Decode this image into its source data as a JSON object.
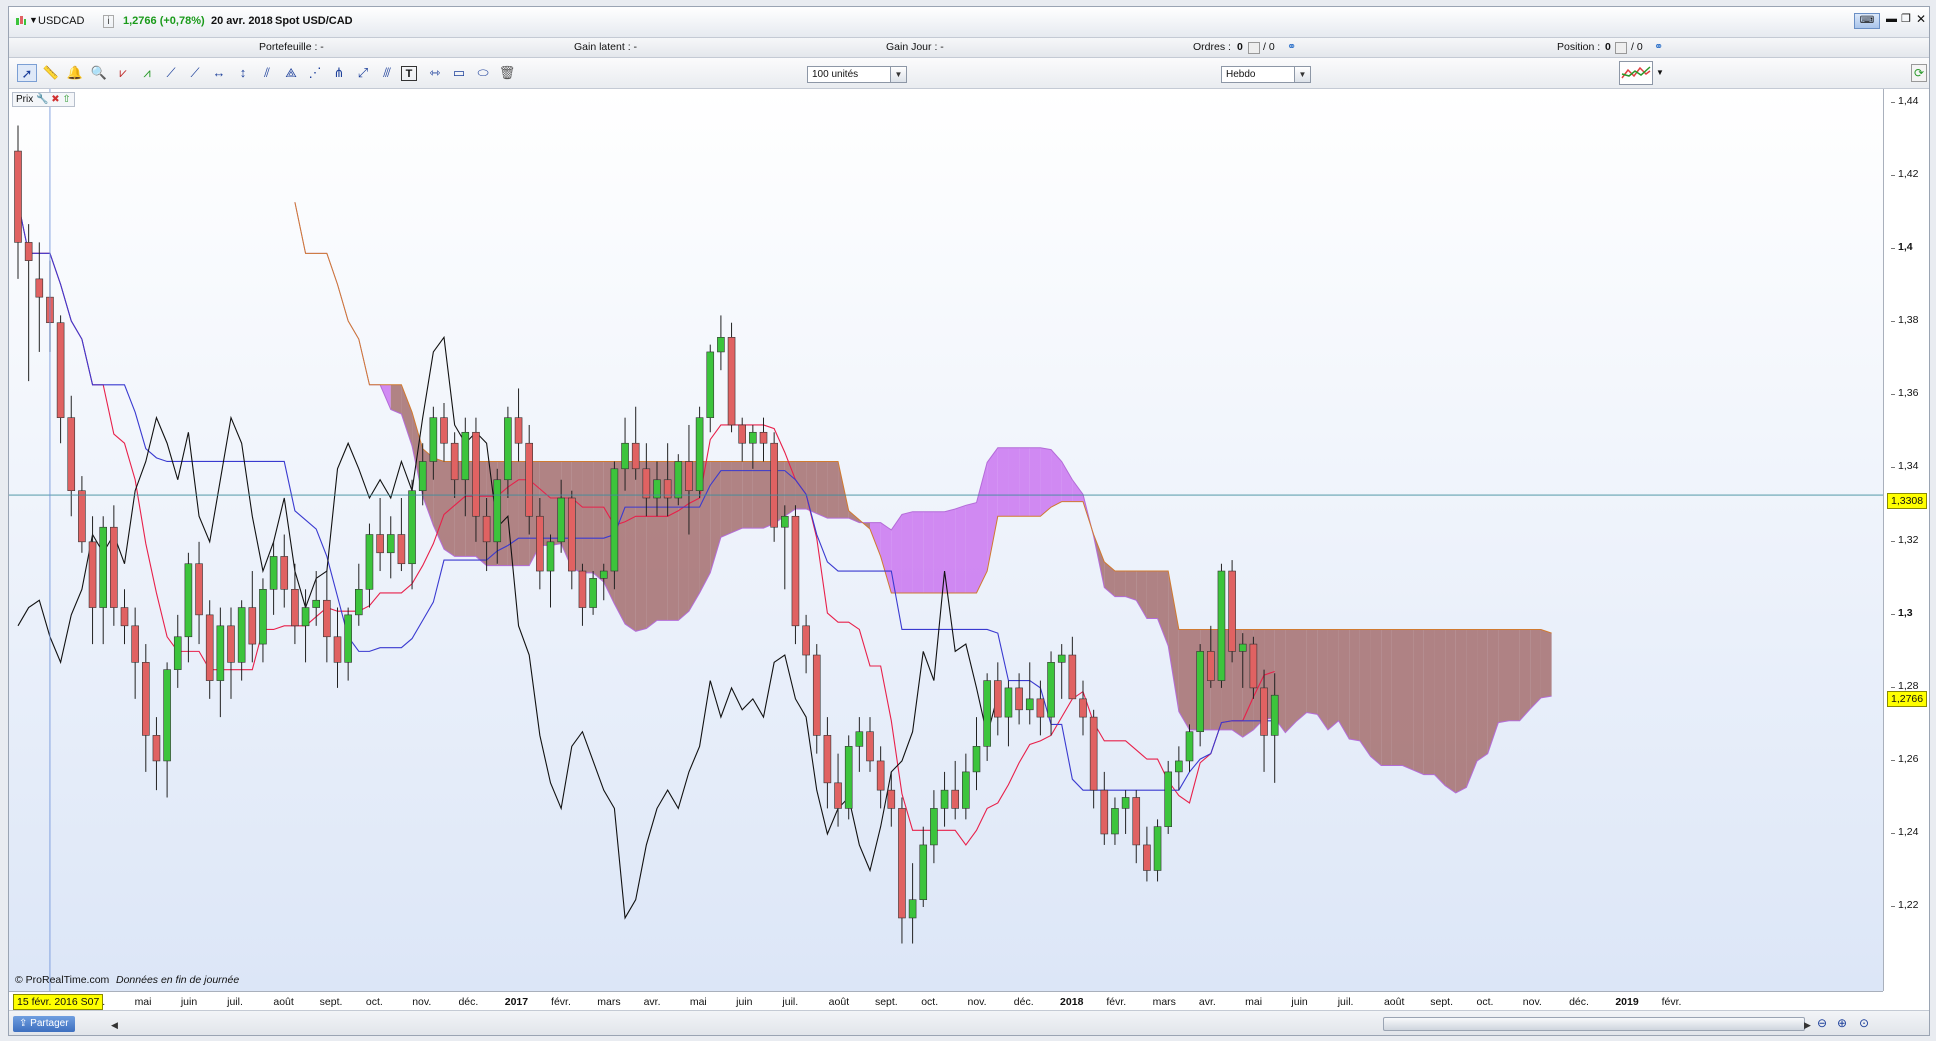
{
  "header": {
    "symbol": "USDCAD",
    "info_icon": "i",
    "price": "1,2766 (+0,78%)",
    "date": "20 avr. 2018",
    "instrument": "Spot USD/CAD"
  },
  "infobar": {
    "portfolio": "Portefeuille : -",
    "unrealized": "Gain latent : -",
    "daily_gain": "Gain Jour : -",
    "orders_label": "Ordres :",
    "orders_value": "0",
    "orders_slash": "/ 0",
    "position_label": "Position :",
    "position_value": "0",
    "position_slash": "/ 0"
  },
  "toolbar": {
    "quantity": "100 unités",
    "period": "Hebdo",
    "tools": [
      "cursor-icon",
      "ruler-icon",
      "alarm-icon",
      "zoom-icon",
      "fibonacci-icon",
      "trend-icon",
      "line-icon",
      "ray-icon",
      "h-line-icon",
      "v-line-icon",
      "channel-icon",
      "andrews-icon",
      "gann-icon",
      "pitchfork-icon",
      "arrow-icon",
      "parallel-icon",
      "text-icon",
      "measure-icon",
      "rectangle-icon",
      "ellipse-icon",
      "trash-icon"
    ]
  },
  "panel": {
    "label": "Prix"
  },
  "yaxis": {
    "labels": [
      "1,44",
      "1,42",
      "1,4",
      "1,38",
      "1,36",
      "1,34",
      "1,32",
      "1,3",
      "1,28",
      "1,26",
      "1,24",
      "1,22"
    ],
    "current_price": "1,2766",
    "crosshair_price": "1,3308"
  },
  "xaxis": {
    "crosshair_date": "15 févr. 2016 S07",
    "labels": [
      "avr.",
      "mai",
      "juin",
      "juil.",
      "août",
      "sept.",
      "oct.",
      "nov.",
      "déc.",
      "2017",
      "févr.",
      "mars",
      "avr.",
      "mai",
      "juin",
      "juil.",
      "août",
      "sept.",
      "oct.",
      "nov.",
      "déc.",
      "2018",
      "févr.",
      "mars",
      "avr.",
      "mai",
      "juin",
      "juil.",
      "août",
      "sept.",
      "oct.",
      "nov.",
      "déc.",
      "2019",
      "févr."
    ]
  },
  "footer": {
    "copyright": "© ProRealTime.com",
    "note": "Données en fin de journée",
    "share": "Partager"
  },
  "colors": {
    "up": "#3cc43c",
    "down": "#e06262",
    "tenkan": "#e8204a",
    "kijun": "#3a3ad0",
    "chikou": "#111111",
    "cloud_bull": "#c86ef0",
    "cloud_bear": "#a56f6f"
  },
  "chart_data": {
    "type": "candlestick",
    "title": "",
    "ylim": [
      1.195,
      1.442
    ],
    "indicators": [
      "Ichimoku"
    ],
    "candles": [
      [
        1.425,
        1.432,
        1.39,
        1.4
      ],
      [
        1.4,
        1.405,
        1.362,
        1.395
      ],
      [
        1.39,
        1.4,
        1.37,
        1.385
      ],
      [
        1.385,
        1.395,
        1.37,
        1.378
      ],
      [
        1.378,
        1.38,
        1.345,
        1.352
      ],
      [
        1.352,
        1.358,
        1.325,
        1.332
      ],
      [
        1.332,
        1.336,
        1.315,
        1.318
      ],
      [
        1.318,
        1.325,
        1.29,
        1.3
      ],
      [
        1.3,
        1.325,
        1.29,
        1.322
      ],
      [
        1.322,
        1.328,
        1.295,
        1.3
      ],
      [
        1.3,
        1.305,
        1.29,
        1.295
      ],
      [
        1.295,
        1.3,
        1.275,
        1.285
      ],
      [
        1.285,
        1.29,
        1.255,
        1.265
      ],
      [
        1.265,
        1.27,
        1.25,
        1.258
      ],
      [
        1.258,
        1.285,
        1.248,
        1.283
      ],
      [
        1.283,
        1.298,
        1.278,
        1.292
      ],
      [
        1.292,
        1.315,
        1.285,
        1.312
      ],
      [
        1.312,
        1.318,
        1.29,
        1.298
      ],
      [
        1.298,
        1.302,
        1.275,
        1.28
      ],
      [
        1.28,
        1.3,
        1.27,
        1.295
      ],
      [
        1.295,
        1.3,
        1.275,
        1.285
      ],
      [
        1.285,
        1.302,
        1.28,
        1.3
      ],
      [
        1.3,
        1.31,
        1.285,
        1.29
      ],
      [
        1.29,
        1.308,
        1.285,
        1.305
      ],
      [
        1.305,
        1.318,
        1.298,
        1.314
      ],
      [
        1.314,
        1.32,
        1.3,
        1.305
      ],
      [
        1.305,
        1.312,
        1.29,
        1.295
      ],
      [
        1.295,
        1.305,
        1.285,
        1.3
      ],
      [
        1.3,
        1.31,
        1.295,
        1.302
      ],
      [
        1.302,
        1.31,
        1.285,
        1.292
      ],
      [
        1.292,
        1.3,
        1.278,
        1.285
      ],
      [
        1.285,
        1.3,
        1.28,
        1.298
      ],
      [
        1.298,
        1.312,
        1.295,
        1.305
      ],
      [
        1.305,
        1.323,
        1.3,
        1.32
      ],
      [
        1.32,
        1.33,
        1.31,
        1.315
      ],
      [
        1.315,
        1.325,
        1.308,
        1.32
      ],
      [
        1.32,
        1.33,
        1.31,
        1.312
      ],
      [
        1.312,
        1.335,
        1.305,
        1.332
      ],
      [
        1.332,
        1.345,
        1.328,
        1.34
      ],
      [
        1.34,
        1.355,
        1.335,
        1.352
      ],
      [
        1.352,
        1.356,
        1.34,
        1.345
      ],
      [
        1.345,
        1.348,
        1.33,
        1.335
      ],
      [
        1.335,
        1.352,
        1.325,
        1.348
      ],
      [
        1.348,
        1.352,
        1.318,
        1.325
      ],
      [
        1.325,
        1.33,
        1.31,
        1.318
      ],
      [
        1.318,
        1.338,
        1.312,
        1.335
      ],
      [
        1.335,
        1.355,
        1.33,
        1.352
      ],
      [
        1.352,
        1.36,
        1.34,
        1.345
      ],
      [
        1.345,
        1.35,
        1.32,
        1.325
      ],
      [
        1.325,
        1.33,
        1.305,
        1.31
      ],
      [
        1.31,
        1.32,
        1.3,
        1.318
      ],
      [
        1.318,
        1.335,
        1.315,
        1.33
      ],
      [
        1.33,
        1.332,
        1.305,
        1.31
      ],
      [
        1.31,
        1.312,
        1.295,
        1.3
      ],
      [
        1.3,
        1.31,
        1.298,
        1.308
      ],
      [
        1.308,
        1.312,
        1.302,
        1.31
      ],
      [
        1.31,
        1.34,
        1.305,
        1.338
      ],
      [
        1.338,
        1.352,
        1.332,
        1.345
      ],
      [
        1.345,
        1.355,
        1.335,
        1.338
      ],
      [
        1.338,
        1.345,
        1.325,
        1.33
      ],
      [
        1.33,
        1.34,
        1.325,
        1.335
      ],
      [
        1.335,
        1.345,
        1.325,
        1.33
      ],
      [
        1.33,
        1.342,
        1.328,
        1.34
      ],
      [
        1.34,
        1.35,
        1.32,
        1.332
      ],
      [
        1.332,
        1.355,
        1.33,
        1.352
      ],
      [
        1.352,
        1.372,
        1.348,
        1.37
      ],
      [
        1.37,
        1.38,
        1.365,
        1.374
      ],
      [
        1.374,
        1.378,
        1.348,
        1.35
      ],
      [
        1.35,
        1.352,
        1.34,
        1.345
      ],
      [
        1.345,
        1.35,
        1.338,
        1.348
      ],
      [
        1.348,
        1.352,
        1.34,
        1.345
      ],
      [
        1.345,
        1.348,
        1.318,
        1.322
      ],
      [
        1.322,
        1.328,
        1.305,
        1.325
      ],
      [
        1.325,
        1.328,
        1.29,
        1.295
      ],
      [
        1.295,
        1.298,
        1.282,
        1.287
      ],
      [
        1.287,
        1.29,
        1.26,
        1.265
      ],
      [
        1.265,
        1.27,
        1.245,
        1.252
      ],
      [
        1.252,
        1.26,
        1.24,
        1.245
      ],
      [
        1.245,
        1.265,
        1.242,
        1.262
      ],
      [
        1.262,
        1.27,
        1.255,
        1.266
      ],
      [
        1.266,
        1.27,
        1.255,
        1.258
      ],
      [
        1.258,
        1.262,
        1.245,
        1.25
      ],
      [
        1.25,
        1.255,
        1.24,
        1.245
      ],
      [
        1.245,
        1.248,
        1.208,
        1.215
      ],
      [
        1.215,
        1.23,
        1.208,
        1.22
      ],
      [
        1.22,
        1.24,
        1.218,
        1.235
      ],
      [
        1.235,
        1.25,
        1.23,
        1.245
      ],
      [
        1.245,
        1.255,
        1.24,
        1.25
      ],
      [
        1.25,
        1.258,
        1.242,
        1.245
      ],
      [
        1.245,
        1.26,
        1.242,
        1.255
      ],
      [
        1.255,
        1.27,
        1.25,
        1.262
      ],
      [
        1.262,
        1.282,
        1.258,
        1.28
      ],
      [
        1.28,
        1.285,
        1.265,
        1.27
      ],
      [
        1.27,
        1.28,
        1.262,
        1.278
      ],
      [
        1.278,
        1.282,
        1.268,
        1.272
      ],
      [
        1.272,
        1.285,
        1.268,
        1.275
      ],
      [
        1.275,
        1.28,
        1.265,
        1.27
      ],
      [
        1.27,
        1.288,
        1.265,
        1.285
      ],
      [
        1.285,
        1.29,
        1.275,
        1.287
      ],
      [
        1.287,
        1.292,
        1.275,
        1.275
      ],
      [
        1.275,
        1.28,
        1.265,
        1.27
      ],
      [
        1.27,
        1.272,
        1.245,
        1.25
      ],
      [
        1.25,
        1.255,
        1.235,
        1.238
      ],
      [
        1.238,
        1.248,
        1.235,
        1.245
      ],
      [
        1.245,
        1.25,
        1.238,
        1.248
      ],
      [
        1.248,
        1.25,
        1.23,
        1.235
      ],
      [
        1.235,
        1.24,
        1.225,
        1.228
      ],
      [
        1.228,
        1.242,
        1.225,
        1.24
      ],
      [
        1.24,
        1.258,
        1.238,
        1.255
      ],
      [
        1.255,
        1.262,
        1.25,
        1.258
      ],
      [
        1.258,
        1.268,
        1.255,
        1.266
      ],
      [
        1.266,
        1.29,
        1.262,
        1.288
      ],
      [
        1.288,
        1.295,
        1.278,
        1.28
      ],
      [
        1.28,
        1.312,
        1.278,
        1.31
      ],
      [
        1.31,
        1.313,
        1.285,
        1.288
      ],
      [
        1.288,
        1.293,
        1.278,
        1.29
      ],
      [
        1.29,
        1.292,
        1.275,
        1.278
      ],
      [
        1.278,
        1.283,
        1.255,
        1.265
      ],
      [
        1.265,
        1.282,
        1.252,
        1.276
      ]
    ]
  }
}
